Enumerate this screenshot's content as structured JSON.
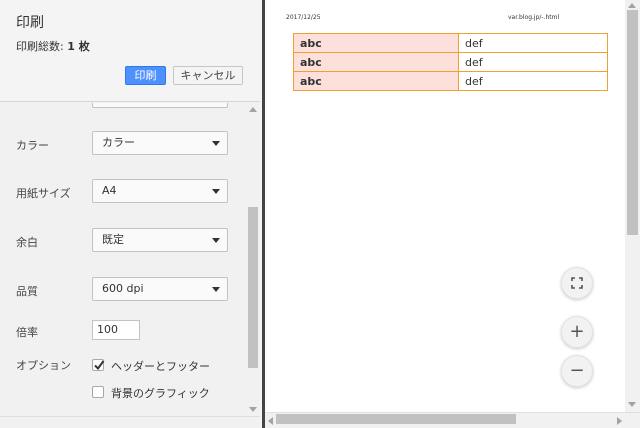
{
  "dialog": {
    "title": "印刷",
    "total_label": "印刷総数:",
    "total_value": "1 枚",
    "print_button": "印刷",
    "cancel_button": "キャンセル"
  },
  "settings": {
    "color": {
      "label": "カラー",
      "value": "カラー"
    },
    "paper_size": {
      "label": "用紙サイズ",
      "value": "A4"
    },
    "margins": {
      "label": "余白",
      "value": "既定"
    },
    "quality": {
      "label": "品質",
      "value": "600 dpi"
    },
    "scale": {
      "label": "倍率",
      "value": "100"
    },
    "options": {
      "label": "オプション",
      "headers_footers": {
        "label": "ヘッダーとフッター",
        "checked": true
      },
      "background_graphics": {
        "label": "背景のグラフィック",
        "checked": false
      }
    }
  },
  "preview": {
    "header_date": "2017/12/25",
    "header_url": "var.blog.jp/-.html",
    "table": [
      [
        "abc",
        "def"
      ],
      [
        "abc",
        "def"
      ],
      [
        "abc",
        "def"
      ]
    ],
    "controls": {
      "fit_icon": "fit-to-page-icon",
      "zoom_in": "+",
      "zoom_out": "−"
    }
  },
  "colors": {
    "primary_button": "#4d90fe",
    "table_border": "#f0a030",
    "table_highlight": "#fde0dc"
  }
}
